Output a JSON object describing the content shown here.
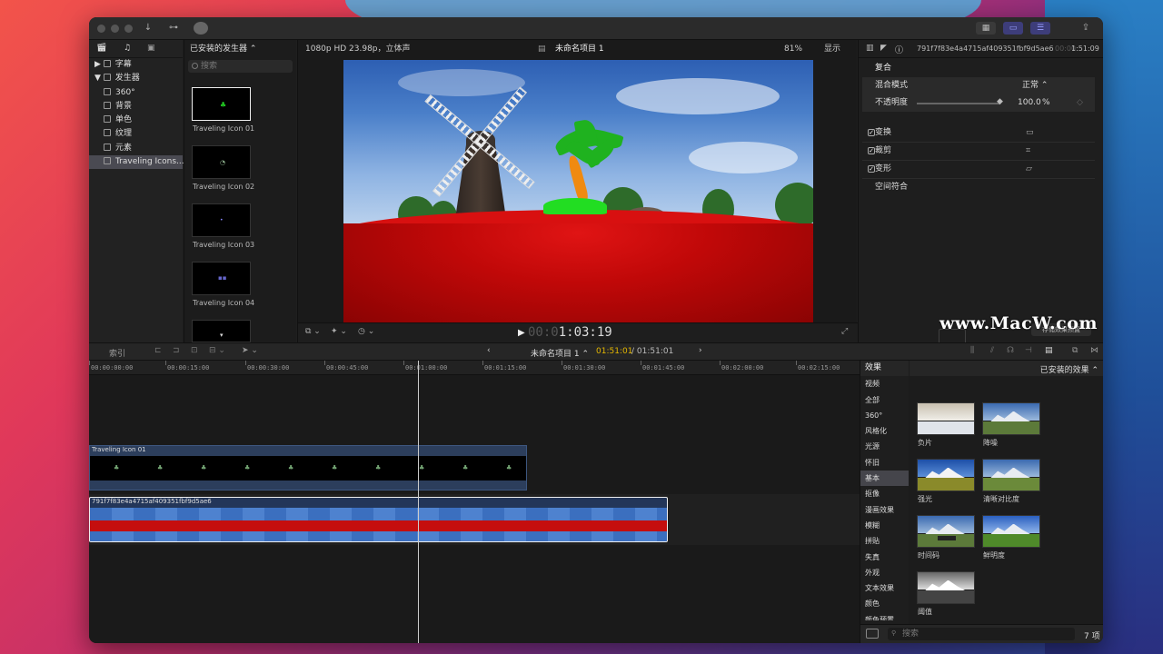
{
  "colors": {
    "accent": "#6f6fff",
    "selection": "#4a4a52",
    "title_clip": "#2c3e5c",
    "video_clip": "#233659"
  },
  "titlebar": {
    "share_icon": "share-icon"
  },
  "library": {
    "items": [
      {
        "label": "字幕",
        "icon": "captions-icon",
        "expander": "▶"
      },
      {
        "label": "发生器",
        "icon": "generators-icon",
        "expander": "▼"
      },
      {
        "label": "360°",
        "icon": "generator-folder-icon"
      },
      {
        "label": "背景",
        "icon": "generator-folder-icon"
      },
      {
        "label": "单色",
        "icon": "generator-folder-icon"
      },
      {
        "label": "纹理",
        "icon": "generator-folder-icon"
      },
      {
        "label": "元素",
        "icon": "generator-folder-icon"
      },
      {
        "label": "Traveling Icons...",
        "icon": "generator-folder-icon"
      }
    ]
  },
  "generators": {
    "header": "已安装的发生器 ⌃",
    "search_placeholder": "搜索",
    "items": [
      {
        "label": "Traveling Icon 01"
      },
      {
        "label": "Traveling Icon 02"
      },
      {
        "label": "Traveling Icon 03"
      },
      {
        "label": "Traveling Icon 04"
      }
    ]
  },
  "viewer": {
    "format": "1080p HD 23.98p，立体声",
    "project_title": "未命名项目 1",
    "zoom": "81%",
    "display_label": "显示",
    "timecode_dim": "00:0",
    "timecode": "1:03:19"
  },
  "inspector": {
    "clip_name": "791f7f83e4a4715af409351fbf9d5ae6",
    "clip_time_dim": "00:00",
    "clip_time": "1:51:09",
    "section": "复合",
    "blend_mode_label": "混合模式",
    "blend_mode_value": "正常 ⌃",
    "opacity_label": "不透明度",
    "opacity_value": "100.0",
    "opacity_unit": "%",
    "transform": "变换",
    "crop": "裁剪",
    "distort": "变形",
    "spatial": "空间符合",
    "save_preset": "存储效果预置"
  },
  "watermark": "www.MacW.com",
  "timeline": {
    "index_label": "索引",
    "project_title": "未命名项目 1 ⌃",
    "timecode_current": "01:51:01",
    "timecode_total": "/ 01:51:01",
    "ruler": [
      "00:00:00:00",
      "00:00:15:00",
      "00:00:30:00",
      "00:00:45:00",
      "00:01:00:00",
      "00:01:15:00",
      "00:01:30:00",
      "00:01:45:00",
      "00:02:00:00",
      "00:02:15:00"
    ],
    "title_clip": "Traveling Icon 01",
    "video_clip": "791f7f83e4a4715af409351fbf9d5ae6"
  },
  "effects": {
    "header": "效果",
    "installed": "已安装的效果 ⌃",
    "categories": [
      "视频",
      "全部",
      "360°",
      "风格化",
      "光源",
      "怀旧",
      "基本",
      "抠像",
      "漫画效果",
      "模糊",
      "拼贴",
      "失真",
      "外观",
      "文本效果",
      "颜色",
      "颜色预置"
    ],
    "selected_category": "基本",
    "items": [
      {
        "label": "负片"
      },
      {
        "label": "降噪"
      },
      {
        "label": "强光"
      },
      {
        "label": "清晰对比度"
      },
      {
        "label": "时间码"
      },
      {
        "label": "鲜明度"
      },
      {
        "label": "阈值"
      }
    ],
    "search_placeholder": "搜索",
    "count": "7 项"
  }
}
